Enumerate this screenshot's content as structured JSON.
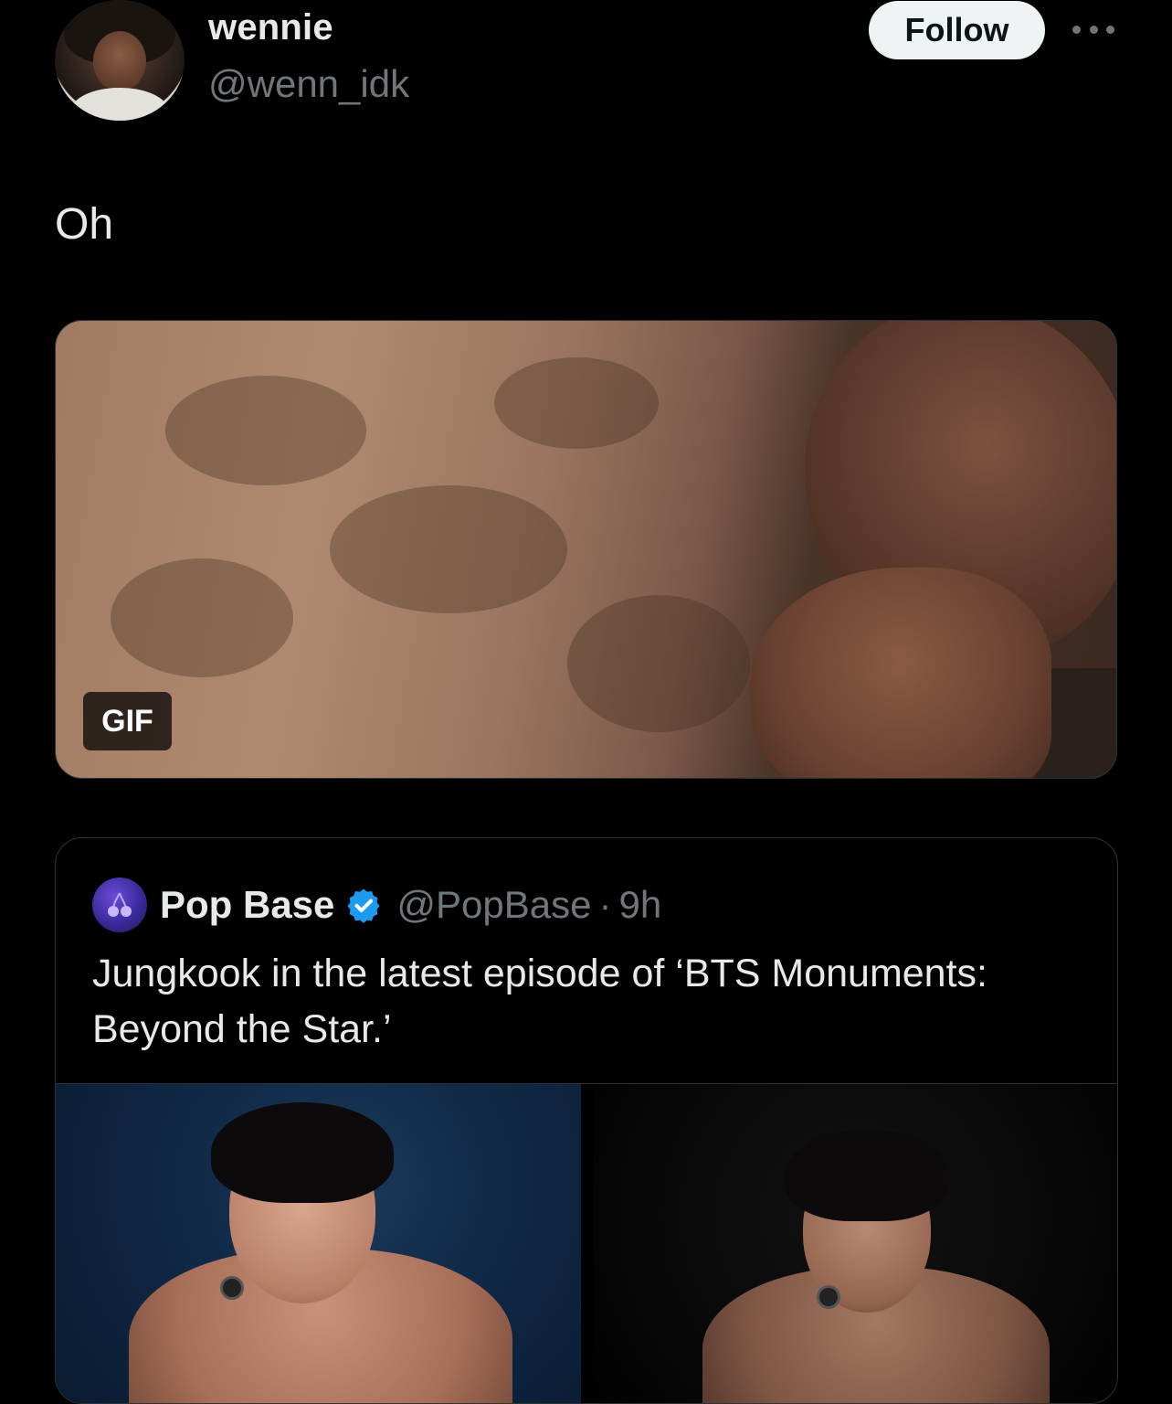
{
  "tweet": {
    "author": {
      "display_name": "wennie",
      "handle": "@wenn_idk"
    },
    "follow_label": "Follow",
    "more_icon": "more-horizontal-icon",
    "text": "Oh",
    "media": {
      "type": "gif",
      "badge": "GIF"
    }
  },
  "quoted_tweet": {
    "author": {
      "display_name": "Pop Base",
      "handle": "@PopBase",
      "verified": true,
      "verified_color": "#1d9bf0"
    },
    "separator": "·",
    "time": "9h",
    "text": "Jungkook in the latest episode of ‘BTS Monuments: Beyond the Star.’",
    "media_count": 2
  },
  "colors": {
    "background": "#000000",
    "primary_text": "#e7e9ea",
    "secondary_text": "#71767b",
    "border": "#2f3336",
    "follow_bg": "#eff3f4",
    "follow_text": "#0f1419"
  }
}
